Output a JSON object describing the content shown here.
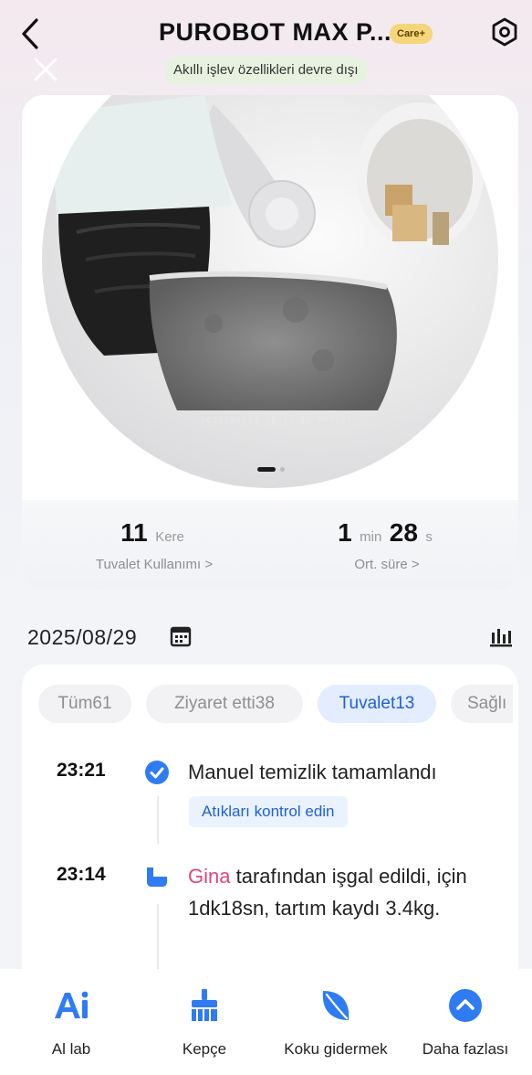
{
  "header": {
    "title": "PUROBOT MAX P...",
    "badge": "Care+",
    "smart_notice": "Akıllı işlev özellikleri devre dışı"
  },
  "camera": {
    "timestamp": "2025/09/21 16:11:19 PETKIT",
    "page_dots": 2,
    "active_page": 1
  },
  "stats": {
    "usage": {
      "value": "11",
      "unit": "Kere",
      "label": "Tuvalet Kullanımı >"
    },
    "duration": {
      "minutes": "1",
      "min_unit": "min",
      "seconds": "28",
      "sec_unit": "s",
      "label": "Ort. süre >"
    }
  },
  "date": {
    "value": "2025/08/29"
  },
  "tabs": [
    {
      "label": "Tüm61",
      "active": false
    },
    {
      "label": "Ziyaret etti38",
      "active": false
    },
    {
      "label": "Tuvalet13",
      "active": true
    },
    {
      "label": "Sağlı",
      "active": false
    }
  ],
  "events": [
    {
      "time": "23:21",
      "text": "Manuel temizlik tamamlandı",
      "action": "Atıkları kontrol edin",
      "icon": "check-circle-icon"
    },
    {
      "time": "23:14",
      "name": "Gina",
      "text": " tarafından işgal edildi, için 1dk18sn, tartım kaydı 3.4kg.",
      "icon": "litter-box-icon"
    }
  ],
  "nav": [
    {
      "label": "Al lab",
      "icon": "ai-lab-icon"
    },
    {
      "label": "Kepçe",
      "icon": "broom-icon"
    },
    {
      "label": "Koku gidermek",
      "icon": "leaf-icon"
    },
    {
      "label": "Daha fazlası",
      "icon": "chevron-up-circle-icon"
    }
  ],
  "colors": {
    "accent": "#1f5fd6",
    "icon_blue": "#2f7bf2",
    "name_pink": "#e0457b",
    "badge": "#f5d67a"
  }
}
